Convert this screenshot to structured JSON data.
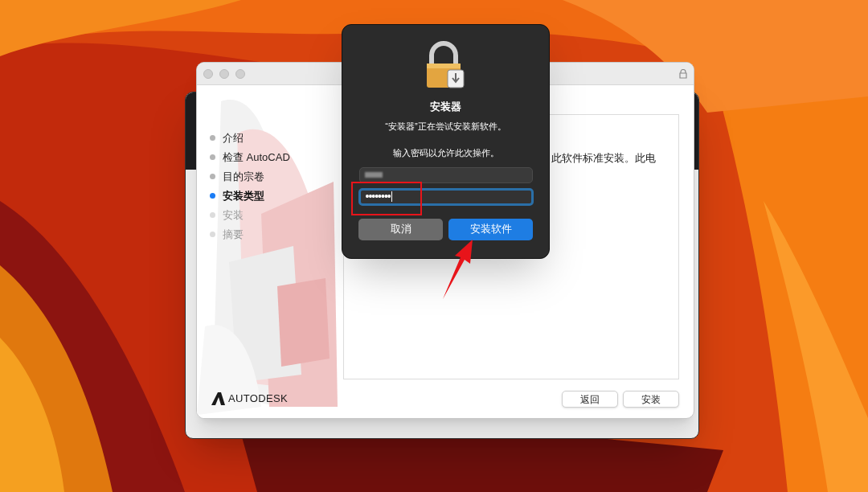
{
  "installer_window": {
    "steps": [
      {
        "label": "介绍",
        "selected": false
      },
      {
        "label": "检查 AutoCAD",
        "selected": false
      },
      {
        "label": "目的宗卷",
        "selected": false
      },
      {
        "label": "安装类型",
        "selected": true
      },
      {
        "label": "安装",
        "selected": false
      },
      {
        "label": "摘要",
        "selected": false
      }
    ],
    "content_text": "此软件标准安装。此电",
    "brand": "AUTODESK",
    "buttons": [
      "返回",
      "安装"
    ]
  },
  "auth_dialog": {
    "title": "安装器",
    "message": "“安装器”正在尝试安装新软件。",
    "prompt": "输入密码以允许此次操作。",
    "password": {
      "value": "••••••••",
      "focused": true
    },
    "buttons": [
      {
        "label": "取消",
        "default": false
      },
      {
        "label": "安装软件",
        "default": true
      }
    ]
  },
  "annotations": [
    {
      "kind": "highlight-box"
    },
    {
      "kind": "arrow"
    }
  ]
}
